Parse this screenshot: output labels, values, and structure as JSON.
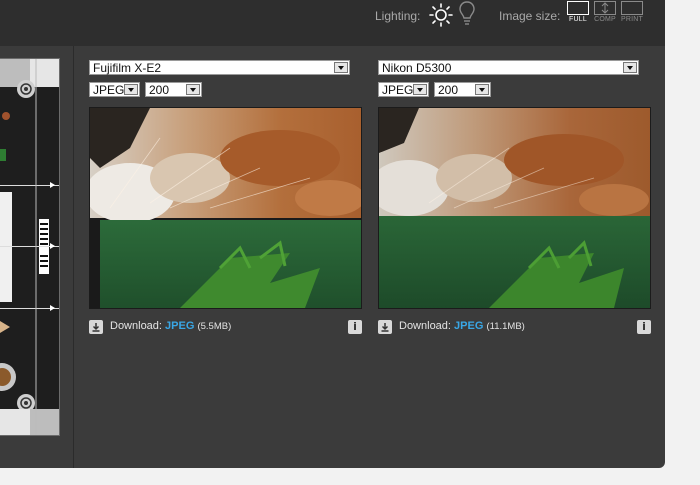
{
  "toolbar": {
    "lighting_label": "Lighting:",
    "image_size_label": "Image size:",
    "size_options": [
      {
        "label": "FULL",
        "active": true
      },
      {
        "label": "COMP",
        "active": false
      },
      {
        "label": "PRINT",
        "active": false
      }
    ]
  },
  "panels": [
    {
      "camera": "Fujifilm X-E2",
      "format": "JPEG",
      "iso": "200",
      "download_label": "Download:",
      "download_format": "JPEG",
      "download_size": "(5.5MB)",
      "info_icon": "i"
    },
    {
      "camera": "Nikon D5300",
      "format": "JPEG",
      "iso": "200",
      "download_label": "Download:",
      "download_format": "JPEG",
      "download_size": "(11.1MB)",
      "info_icon": "i"
    }
  ],
  "colors": {
    "accent": "#39a7e6",
    "background": "#3b3b3b",
    "topbar": "#2e2e2e"
  }
}
